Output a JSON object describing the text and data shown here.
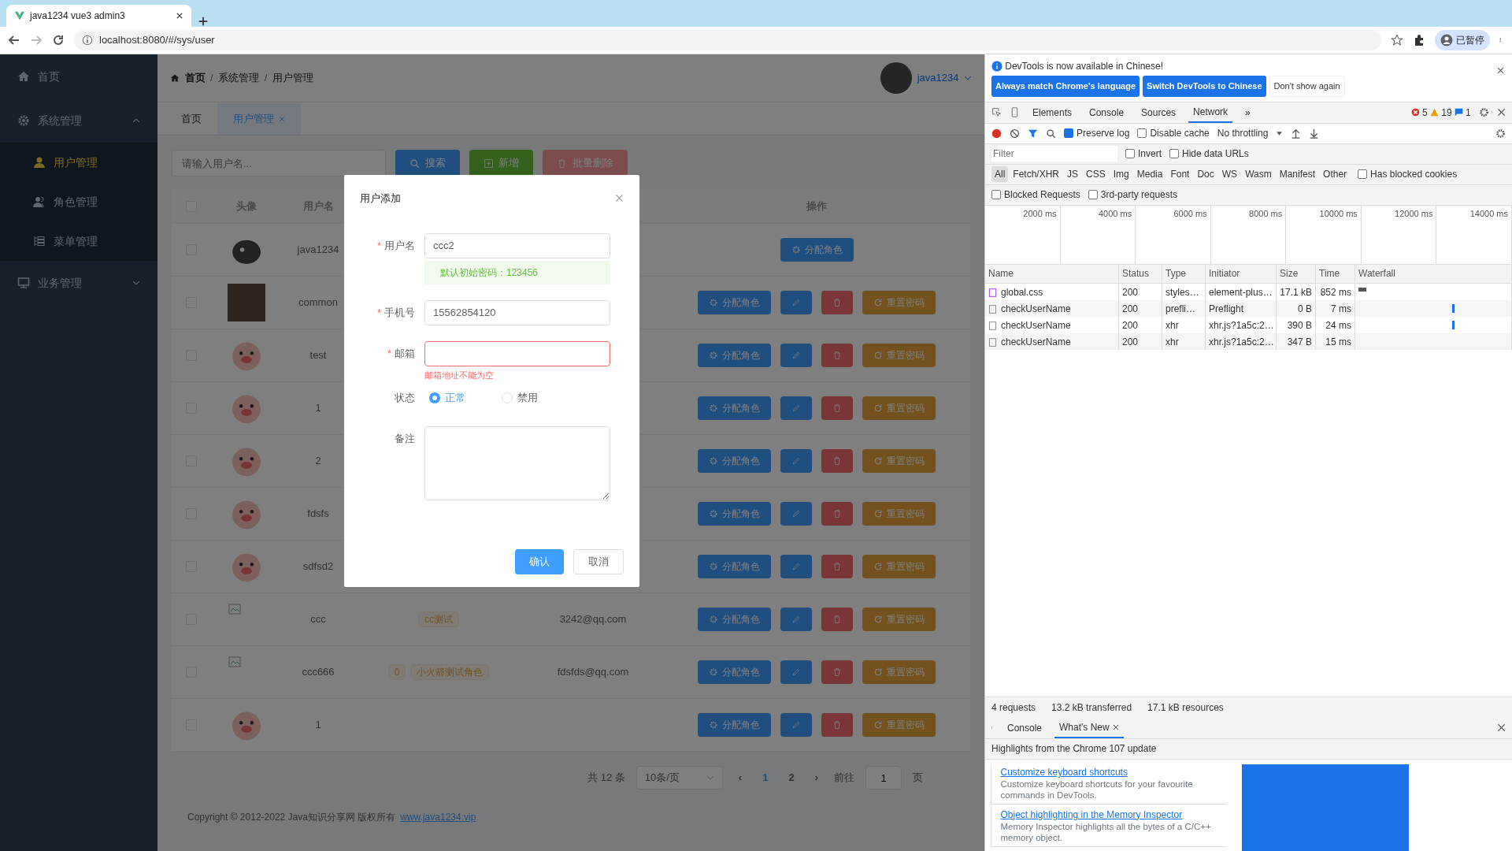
{
  "browser": {
    "tab_title": "java1234 vue3 admin3",
    "url": "localhost:8080/#/sys/user",
    "profile_label": "已暂停"
  },
  "sidebar": {
    "items": [
      {
        "label": "首页"
      },
      {
        "label": "系统管理",
        "expanded": true,
        "children": [
          {
            "label": "用户管理",
            "selected": true
          },
          {
            "label": "角色管理",
            "selected": false
          },
          {
            "label": "菜单管理",
            "selected": false
          }
        ]
      },
      {
        "label": "业务管理",
        "expanded": false
      }
    ]
  },
  "header": {
    "breadcrumb": [
      "首页",
      "系统管理",
      "用户管理"
    ],
    "breadcrumb_separator": "/",
    "user_name": "java1234"
  },
  "tabs": [
    {
      "label": "首页",
      "selected": false,
      "closable": false
    },
    {
      "label": "用户管理",
      "selected": true,
      "closable": true
    }
  ],
  "toolbar": {
    "search": {
      "placeholder": "请输入用户名..."
    },
    "buttons": [
      {
        "label": "搜索",
        "kind": "primary"
      },
      {
        "label": "新增",
        "kind": "success"
      },
      {
        "label": "批量删除",
        "kind": "danger"
      }
    ]
  },
  "table": {
    "select_all_checked": false,
    "columns": [
      "头像",
      "用户名",
      "操作"
    ],
    "rows": [
      {
        "kind": "cartoon",
        "checked": false,
        "username": "java1234",
        "roles": [],
        "assign_label": "分配角色"
      },
      {
        "kind": "photo",
        "checked": false,
        "username": "common",
        "roles": [],
        "assign_label": "分配角色",
        "reset_label": "重置密码"
      },
      {
        "kind": "cartoon",
        "checked": false,
        "username": "test",
        "roles": [],
        "assign_label": "分配角色",
        "reset_label": "重置密码"
      },
      {
        "kind": "cartoon",
        "checked": false,
        "username": "1",
        "roles": [],
        "assign_label": "分配角色",
        "reset_label": "重置密码"
      },
      {
        "kind": "cartoon",
        "checked": false,
        "username": "2",
        "roles": [],
        "assign_label": "分配角色",
        "reset_label": "重置密码"
      },
      {
        "kind": "cartoon",
        "checked": false,
        "username": "fdsfs",
        "roles": [],
        "assign_label": "分配角色",
        "reset_label": "重置密码"
      },
      {
        "kind": "cartoon",
        "checked": false,
        "username": "sdfsd2",
        "roles": [],
        "assign_label": "分配角色",
        "reset_label": "重置密码"
      },
      {
        "kind": "broken",
        "checked": false,
        "username": "ccc",
        "roles": [
          "cc测试"
        ],
        "email": "3242@qq.com",
        "assign_label": "分配角色",
        "reset_label": "重置密码"
      },
      {
        "kind": "broken",
        "checked": false,
        "username": "ccc666",
        "roles": [
          "0",
          "小火箭测试角色"
        ],
        "email": "fdsfds@qq.com",
        "assign_label": "分配角色",
        "reset_label": "重置密码"
      },
      {
        "kind": "cartoon",
        "checked": false,
        "username": "1",
        "roles": [],
        "assign_label": "分配角色",
        "reset_label": "重置密码"
      }
    ]
  },
  "pagination": {
    "total": "共 12 条",
    "page_size": "10条/页",
    "prev": "‹",
    "pages": [
      {
        "label": "1",
        "selected": true
      },
      {
        "label": "2",
        "selected": false
      }
    ],
    "next": "›",
    "goto_label": "前往",
    "goto_value": "1",
    "page_unit": "页"
  },
  "footer": {
    "text": "Copyright © 2012-2022 Java知识分享网 版权所有",
    "link": "www.java1234.vip"
  },
  "dialog": {
    "title": "用户添加",
    "required_mark": "*",
    "fields": [
      {
        "kind": "input",
        "label": "用户名",
        "required": true,
        "value": "ccc2",
        "hint": "默认初始密码：123456"
      },
      {
        "kind": "input",
        "label": "手机号",
        "required": true,
        "value": "15562854120"
      },
      {
        "kind": "input",
        "label": "邮箱",
        "required": true,
        "error": "邮箱地址不能为空"
      },
      {
        "kind": "radio",
        "label": "状态",
        "required": false,
        "options": [
          {
            "label": "正常",
            "selected": true
          },
          {
            "label": "禁用",
            "selected": false
          }
        ]
      },
      {
        "kind": "textarea",
        "label": "备注",
        "required": false
      }
    ],
    "buttons": [
      {
        "label": "确认",
        "kind": "primary"
      },
      {
        "label": "取消",
        "kind": "default"
      }
    ]
  },
  "devtools": {
    "banner": {
      "message": "DevTools is now available in Chinese!",
      "buttons": [
        {
          "label": "Always match Chrome's language",
          "kind": "primary"
        },
        {
          "label": "Switch DevTools to Chinese",
          "kind": "primary"
        },
        {
          "label": "Don't show again",
          "kind": "plain"
        }
      ]
    },
    "tabs": [
      {
        "label": "Elements",
        "selected": false
      },
      {
        "label": "Console",
        "selected": false
      },
      {
        "label": "Sources",
        "selected": false
      },
      {
        "label": "Network",
        "selected": true
      }
    ],
    "more": "»",
    "errors": "5",
    "warnings": "19",
    "messages": "1",
    "preserve_log": {
      "label": "Preserve log",
      "checked": true
    },
    "disable_cache": {
      "label": "Disable cache",
      "checked": false
    },
    "throttling": "No throttling",
    "filter": {
      "placeholder": "Filter"
    },
    "invert": {
      "label": "Invert",
      "checked": false
    },
    "hide_data_urls": {
      "label": "Hide data URLs",
      "checked": false
    },
    "type_filters": [
      {
        "label": "All",
        "selected": true
      },
      {
        "label": "Fetch/XHR",
        "selected": false
      },
      {
        "label": "JS",
        "selected": false
      },
      {
        "label": "CSS",
        "selected": false
      },
      {
        "label": "Img",
        "selected": false
      },
      {
        "label": "Media",
        "selected": false
      },
      {
        "label": "Font",
        "selected": false
      },
      {
        "label": "Doc",
        "selected": false
      },
      {
        "label": "WS",
        "selected": false
      },
      {
        "label": "Wasm",
        "selected": false
      },
      {
        "label": "Manifest",
        "selected": false
      },
      {
        "label": "Other",
        "selected": false
      }
    ],
    "has_blocked_cookies": {
      "label": "Has blocked cookies",
      "checked": false
    },
    "blocked_requests": {
      "label": "Blocked Requests",
      "checked": false
    },
    "third_party": {
      "label": "3rd-party requests",
      "checked": false
    },
    "ticks": [
      "2000 ms",
      "4000 ms",
      "6000 ms",
      "8000 ms",
      "10000 ms",
      "12000 ms",
      "14000 ms"
    ],
    "columns": [
      "Name",
      "Status",
      "Type",
      "Initiator",
      "Size",
      "Time",
      "Waterfall"
    ],
    "requests": [
      {
        "kind": "css",
        "name": "global.css",
        "status": "200",
        "type": "styles…",
        "initiator": "element-plus…",
        "size": "17.1 kB",
        "time": "852 ms"
      },
      {
        "kind": "doc",
        "name": "checkUserName",
        "status": "200",
        "type": "prefli…",
        "initiator": "Preflight",
        "size": "0 B",
        "time": "7 ms"
      },
      {
        "kind": "doc",
        "name": "checkUserName",
        "status": "200",
        "type": "xhr",
        "initiator": "xhr.js?1a5c:2…",
        "size": "390 B",
        "time": "24 ms"
      },
      {
        "kind": "doc",
        "name": "checkUserName",
        "status": "200",
        "type": "xhr",
        "initiator": "xhr.js?1a5c:2…",
        "size": "347 B",
        "time": "15 ms"
      }
    ],
    "summary": [
      "4 requests",
      "13.2 kB transferred",
      "17.1 kB resources"
    ],
    "drawer": {
      "tabs": [
        {
          "label": "Console",
          "selected": false,
          "closable": false
        },
        {
          "label": "What's New",
          "selected": true,
          "closable": true
        }
      ],
      "heading": "Highlights from the Chrome 107 update",
      "items": [
        {
          "title": "Customize keyboard shortcuts",
          "text": "Customize keyboard shortcuts for your favourite commands in DevTools."
        },
        {
          "title": "Object highlighting in the Memory Inspector",
          "text": "Memory Inspector highlights all the bytes of a C/C++ memory object."
        }
      ]
    }
  }
}
